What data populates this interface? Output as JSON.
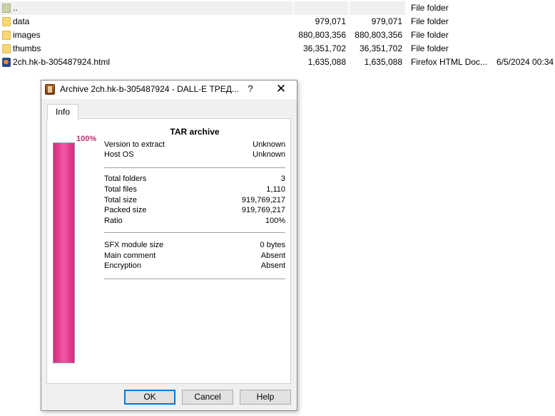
{
  "files": [
    {
      "name": "..",
      "size": "",
      "packed": "",
      "type": "File folder",
      "modified": "",
      "icon": "up-folder-icon"
    },
    {
      "name": "data",
      "size": "979,071",
      "packed": "979,071",
      "type": "File folder",
      "modified": "",
      "icon": "folder-icon"
    },
    {
      "name": "images",
      "size": "880,803,356",
      "packed": "880,803,356",
      "type": "File folder",
      "modified": "",
      "icon": "folder-icon"
    },
    {
      "name": "thumbs",
      "size": "36,351,702",
      "packed": "36,351,702",
      "type": "File folder",
      "modified": "",
      "icon": "folder-icon"
    },
    {
      "name": "2ch.hk-b-305487924.html",
      "size": "1,635,088",
      "packed": "1,635,088",
      "type": "Firefox HTML Doc...",
      "modified": "6/5/2024 00:34",
      "icon": "html-file-icon"
    }
  ],
  "dialog": {
    "title": "Archive 2ch.hk-b-305487924 - DALL-E ТРЕД...",
    "help_label": "?",
    "close_label": "✕",
    "tab_label": "Info",
    "progress_label": "100%",
    "progress_fraction": 1.0,
    "progress_color": "#e83a8e",
    "archive_type": "TAR archive",
    "group1": [
      {
        "label": "Version to extract",
        "value": "Unknown"
      },
      {
        "label": "Host OS",
        "value": "Unknown"
      }
    ],
    "group2": [
      {
        "label": "Total folders",
        "value": "3"
      },
      {
        "label": "Total files",
        "value": "1,110"
      },
      {
        "label": "Total size",
        "value": "919,769,217"
      },
      {
        "label": "Packed size",
        "value": "919,769,217"
      },
      {
        "label": "Ratio",
        "value": "100%"
      }
    ],
    "group3": [
      {
        "label": "SFX module size",
        "value": "0 bytes"
      },
      {
        "label": "Main comment",
        "value": "Absent"
      },
      {
        "label": "Encryption",
        "value": "Absent"
      }
    ],
    "ok_label": "OK",
    "cancel_label": "Cancel",
    "help_button_label": "Help"
  }
}
